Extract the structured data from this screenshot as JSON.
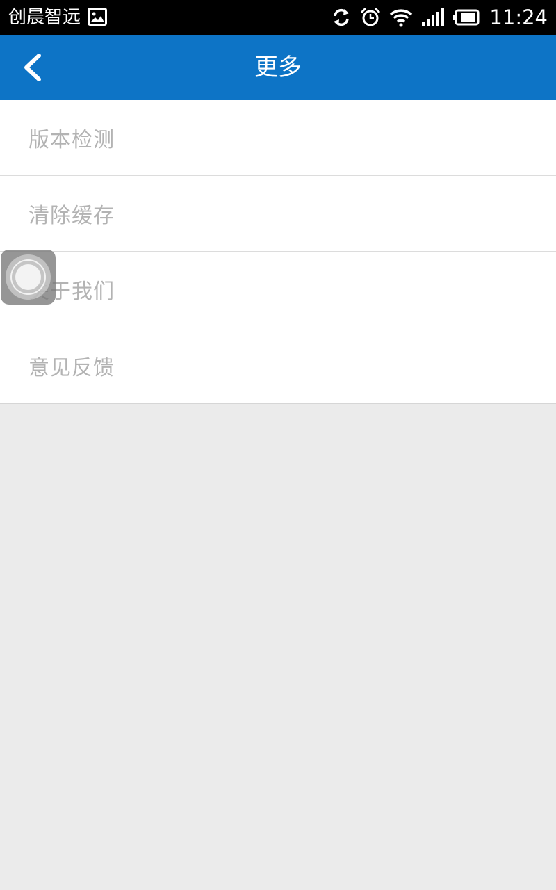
{
  "status_bar": {
    "carrier": "创晨智远",
    "time": "11:24",
    "icons": [
      "gallery-icon",
      "sync-icon",
      "alarm-icon",
      "wifi-icon",
      "signal-icon",
      "battery-icon"
    ]
  },
  "app_bar": {
    "title": "更多",
    "back_icon": "back-chevron-icon",
    "color": "#0d74c6"
  },
  "menu": {
    "items": [
      {
        "label": "版本检测"
      },
      {
        "label": "清除缓存"
      },
      {
        "label": "关于我们"
      },
      {
        "label": "意见反馈"
      }
    ]
  },
  "floating": {
    "icon": "assistive-touch-icon"
  }
}
